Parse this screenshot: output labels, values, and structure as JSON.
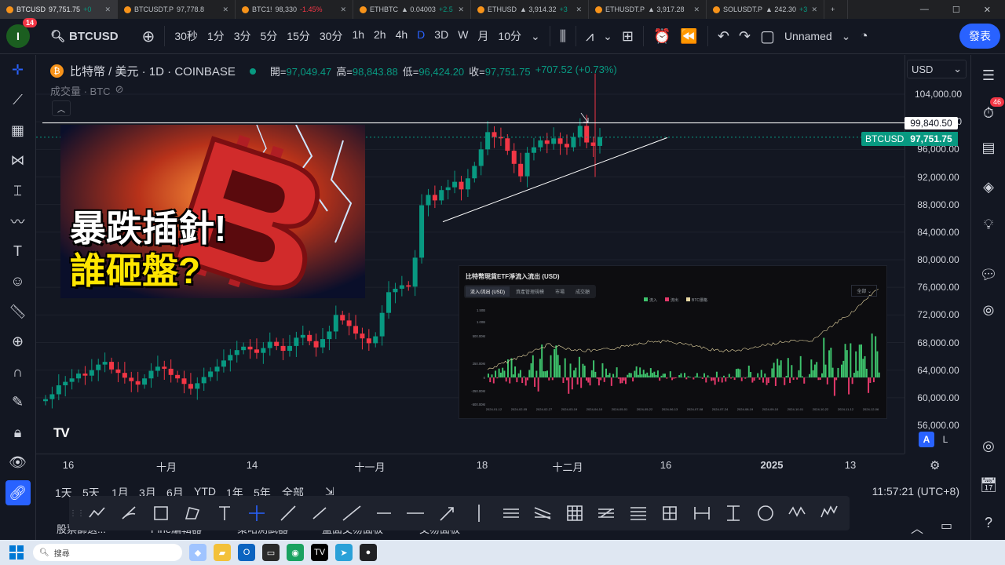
{
  "browser_tabs": [
    {
      "symbol": "BTCUSD",
      "price": "97,751.75",
      "change": "+0",
      "neg": false,
      "active": true
    },
    {
      "symbol": "BTCUSDT.P",
      "price": "97,778.8",
      "change": "",
      "neg": false,
      "active": false
    },
    {
      "symbol": "BTC1!",
      "price": "98,330",
      "change": "-1.45%",
      "neg": true,
      "active": false
    },
    {
      "symbol": "ETHBTC",
      "price": "▲ 0.04003",
      "change": "+2.5",
      "neg": false,
      "active": false
    },
    {
      "symbol": "ETHUSD",
      "price": "▲ 3,914.32",
      "change": "+3",
      "neg": false,
      "active": false
    },
    {
      "symbol": "ETHUSDT.P",
      "price": "▲ 3,917.28",
      "change": "",
      "neg": false,
      "active": false
    },
    {
      "symbol": "SOLUSDT.P",
      "price": "▲ 242.30",
      "change": "+3",
      "neg": false,
      "active": false
    }
  ],
  "toolbar": {
    "avatar_letter": "I",
    "notif_count": "14",
    "symbol": "BTCUSD",
    "intervals": [
      "30秒",
      "1分",
      "3分",
      "5分",
      "15分",
      "30分",
      "1h",
      "2h",
      "4h",
      "D",
      "3D",
      "W",
      "月",
      "10分"
    ],
    "active_interval": "D",
    "layout_name": "Unnamed",
    "publish_label": "發表"
  },
  "legend": {
    "title": "比特幣 / 美元 · 1D · COINBASE",
    "open_label": "開=",
    "open": "97,049.47",
    "high_label": "高=",
    "high": "98,843.88",
    "low_label": "低=",
    "low": "96,424.20",
    "close_label": "收=",
    "close": "97,751.75",
    "change": "+707.52 (+0.73%)",
    "volume_label": "成交量 · BTC"
  },
  "thumbnail": {
    "line1": "暴跌插針!",
    "line2": "誰砸盤?"
  },
  "etf_panel": {
    "title": "比特幣現貨ETF淨流入流出 (USD)",
    "tabs": [
      "流入/流出 (USD)",
      "資產管理規模",
      "市場",
      "成交額"
    ],
    "range": "全部",
    "legend": [
      "流入",
      "流出",
      "BTC價格"
    ],
    "y_labels": [
      "1.50B",
      "1.00B",
      "500.00M",
      "250.00M",
      "0",
      "-250.00M",
      "-500.00M"
    ],
    "x_labels": [
      "2024-01-12",
      "2024-02-05",
      "2024-02-27",
      "2024-03-19",
      "2024-04-10",
      "2024-05-01",
      "2024-05-22",
      "2024-06-13",
      "2024-07-08",
      "2024-07-24",
      "2024-08-19",
      "2024-09-10",
      "2024-10-01",
      "2024-10-22",
      "2024-11-12",
      "2024-12-06"
    ],
    "colors": {
      "in": "#3ec46d",
      "out": "#e5396b",
      "price": "#e8d8a4"
    }
  },
  "chart_data": {
    "type": "candlestick",
    "symbol": "BTCUSD",
    "interval": "1D",
    "ylim": [
      56000,
      106000
    ],
    "price_labels": [
      "104,000.00",
      "100,000.00",
      "96,000.00",
      "92,000.00",
      "88,000.00",
      "84,000.00",
      "80,000.00",
      "76,000.00",
      "72,000.00",
      "68,000.00",
      "64,000.00",
      "60,000.00",
      "56,000.00"
    ],
    "horizontal_line": "99,840.50",
    "last_price": "97,751.75",
    "time_labels": [
      "16",
      "十月",
      "14",
      "十一月",
      "18",
      "十二月",
      "16",
      "2025",
      "13"
    ],
    "bold_time_labels": [
      "2025"
    ],
    "colors": {
      "up": "#089981",
      "down": "#f23645"
    }
  },
  "price_axis": {
    "currency": "USD",
    "auto": "A",
    "log": "L"
  },
  "range_buttons": [
    "1天",
    "5天",
    "1月",
    "3月",
    "6月",
    "YTD",
    "1年",
    "5年",
    "全部"
  ],
  "clock": "11:57:21 (UTC+8)",
  "bottom_tabs": [
    "股票篩選...",
    "Pine編輯器",
    "策略測試器",
    "盤面交易面板",
    "交易面板"
  ],
  "taskbar": {
    "search_placeholder": "搜尋"
  }
}
